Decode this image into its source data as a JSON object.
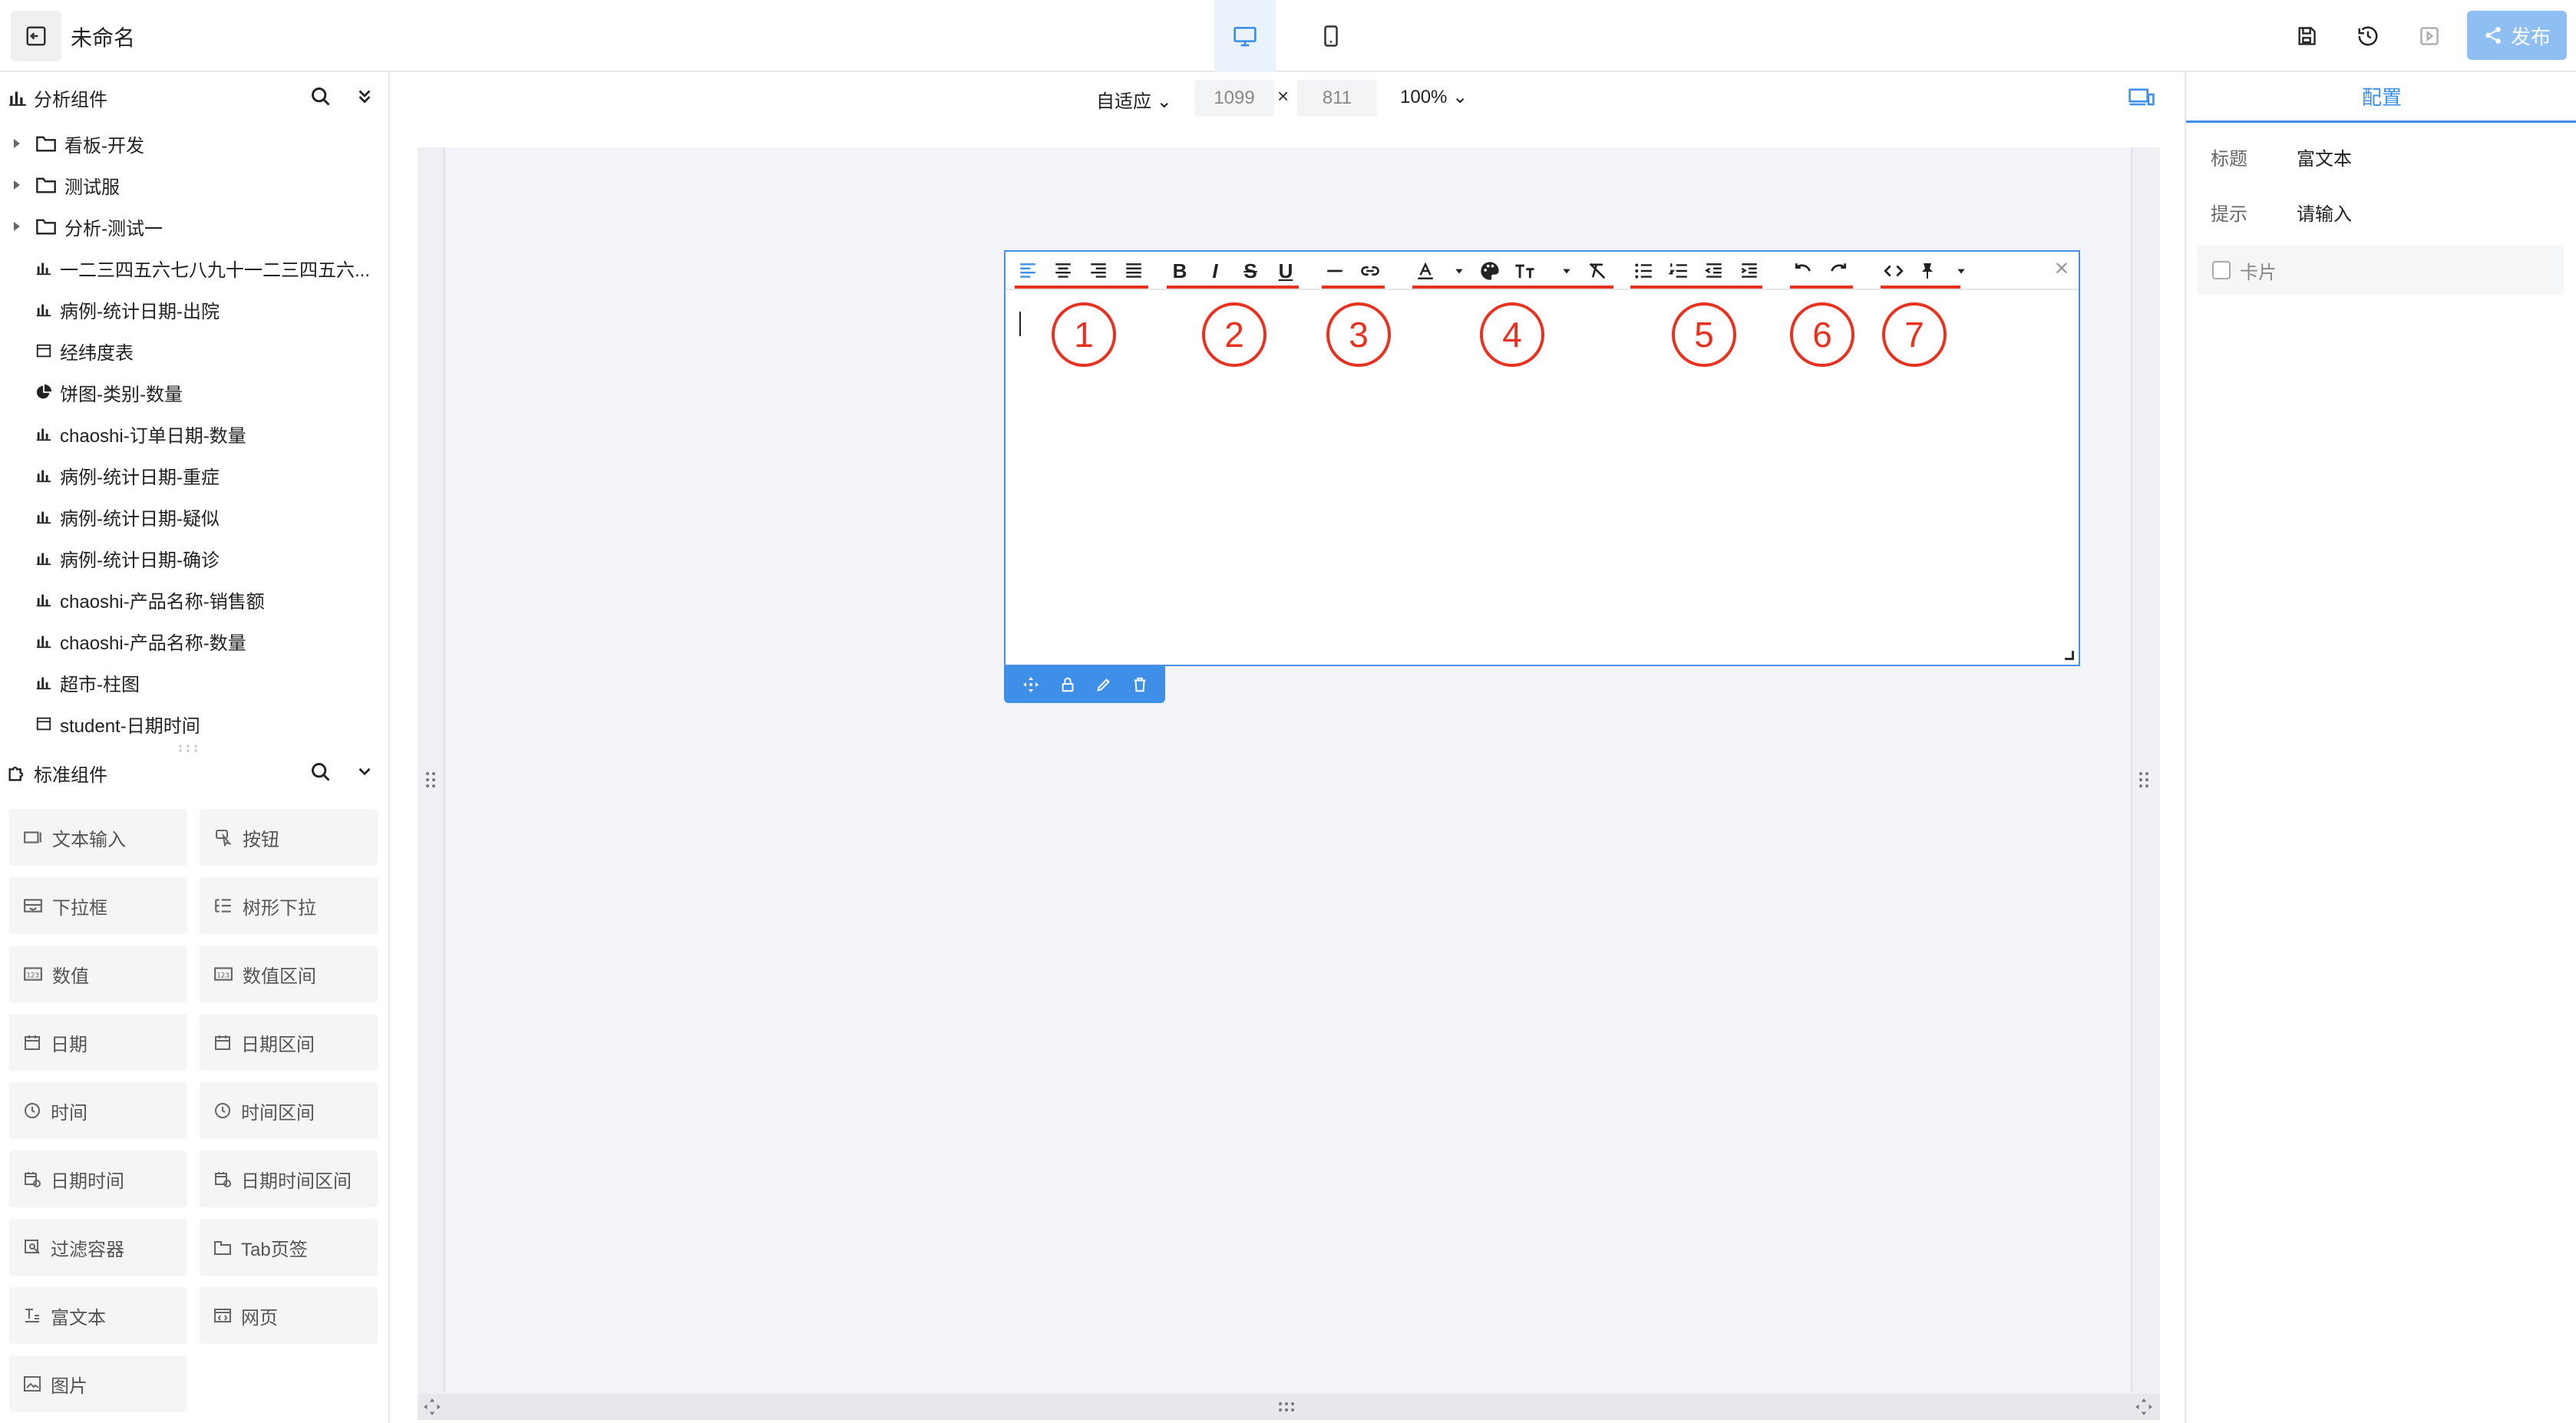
{
  "header": {
    "title": "未命名",
    "publish_label": "发布"
  },
  "left": {
    "analysis": {
      "title": "分析组件",
      "folders": [
        "看板-开发",
        "测试服",
        "分析-测试一"
      ],
      "items": [
        {
          "label": "一二三四五六七八九十一二三四五六...",
          "icon": "bar-chart-icon"
        },
        {
          "label": "病例-统计日期-出院",
          "icon": "bar-chart-icon"
        },
        {
          "label": "经纬度表",
          "icon": "table-icon"
        },
        {
          "label": "饼图-类别-数量",
          "icon": "pie-chart-icon"
        },
        {
          "label": "chaoshi-订单日期-数量",
          "icon": "bar-chart-icon"
        },
        {
          "label": "病例-统计日期-重症",
          "icon": "bar-chart-icon"
        },
        {
          "label": "病例-统计日期-疑似",
          "icon": "bar-chart-icon"
        },
        {
          "label": "病例-统计日期-确诊",
          "icon": "bar-chart-icon"
        },
        {
          "label": "chaoshi-产品名称-销售额",
          "icon": "bar-chart-icon"
        },
        {
          "label": "chaoshi-产品名称-数量",
          "icon": "bar-chart-icon"
        },
        {
          "label": "超市-柱图",
          "icon": "bar-chart-icon"
        },
        {
          "label": "student-日期时间",
          "icon": "table-icon"
        }
      ]
    },
    "standard": {
      "title": "标准组件",
      "items": [
        "文本输入",
        "按钮",
        "下拉框",
        "树形下拉",
        "数值",
        "数值区间",
        "日期",
        "日期区间",
        "时间",
        "时间区间",
        "日期时间",
        "日期时间区间",
        "过滤容器",
        "Tab页签",
        "富文本",
        "网页",
        "图片"
      ]
    }
  },
  "canvas": {
    "mode_label": "自适应",
    "width_value": "1099",
    "height_value": "811",
    "times_sign": "×",
    "zoom_label": "100%"
  },
  "editor": {
    "circles": [
      "1",
      "2",
      "3",
      "4",
      "5",
      "6",
      "7"
    ],
    "toolbar_glyphs": {
      "bold": "B",
      "italic": "I",
      "strike": "S",
      "underline": "U"
    },
    "close_glyph": "✕",
    "highlight_color": "#e8321f"
  },
  "right": {
    "tab_label": "配置",
    "rows": [
      {
        "key": "标题",
        "value": "富文本"
      },
      {
        "key": "提示",
        "value": "请输入"
      }
    ],
    "card_label": "卡片"
  },
  "colors": {
    "accent": "#3d8fe8",
    "publish_bg": "#8fbef2"
  }
}
